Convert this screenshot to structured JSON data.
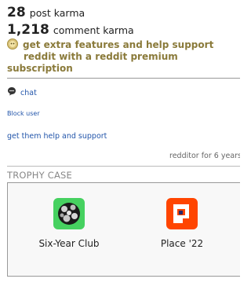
{
  "karma": {
    "post_value": "28",
    "post_label": "post karma",
    "comment_value": "1,218",
    "comment_label": "comment karma"
  },
  "premium": {
    "line1": "get extra features and help support",
    "line2": "reddit with a reddit premium",
    "line3": "subscription",
    "coin_icon": "premium-coin-icon"
  },
  "actions": {
    "chat_label": "chat",
    "chat_icon": "chat-bubble-icon",
    "block_label": "Block user",
    "help_label": "get them help and support"
  },
  "account_age": "redditor for 6 years",
  "trophy_case": {
    "title": "TROPHY CASE",
    "trophies": [
      {
        "name": "Six-Year Club",
        "icon": "six-year-club-icon"
      },
      {
        "name": "Place '22",
        "icon": "place-22-icon"
      }
    ]
  },
  "colors": {
    "link": "#2255aa",
    "premium_text": "#8a7a3a",
    "place_orange": "#ff4500",
    "six_year_green": "#46d160"
  }
}
